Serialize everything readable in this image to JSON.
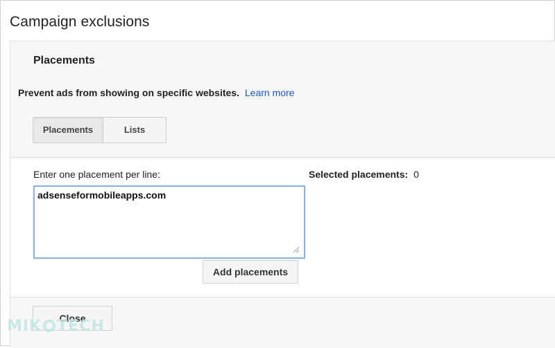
{
  "dialog": {
    "title": "Campaign exclusions"
  },
  "placements": {
    "section_title": "Placements",
    "description": "Prevent ads from showing on specific websites.",
    "learn_more": "Learn more",
    "tabs": [
      {
        "label": "Placements",
        "active": true
      },
      {
        "label": "Lists",
        "active": false
      }
    ]
  },
  "editor": {
    "field_label": "Enter one placement per line:",
    "value": "adsenseformobileapps.com",
    "selected_label": "Selected placements:",
    "selected_count": "0",
    "add_button": "Add placements"
  },
  "footer": {
    "close_button": "Close"
  },
  "watermark": {
    "text_left": "MIK",
    "text_right": "TECH"
  },
  "colors": {
    "link": "#1a55c7",
    "focus_border": "#8ab0ec",
    "panel_bg": "#f7f7f7"
  }
}
